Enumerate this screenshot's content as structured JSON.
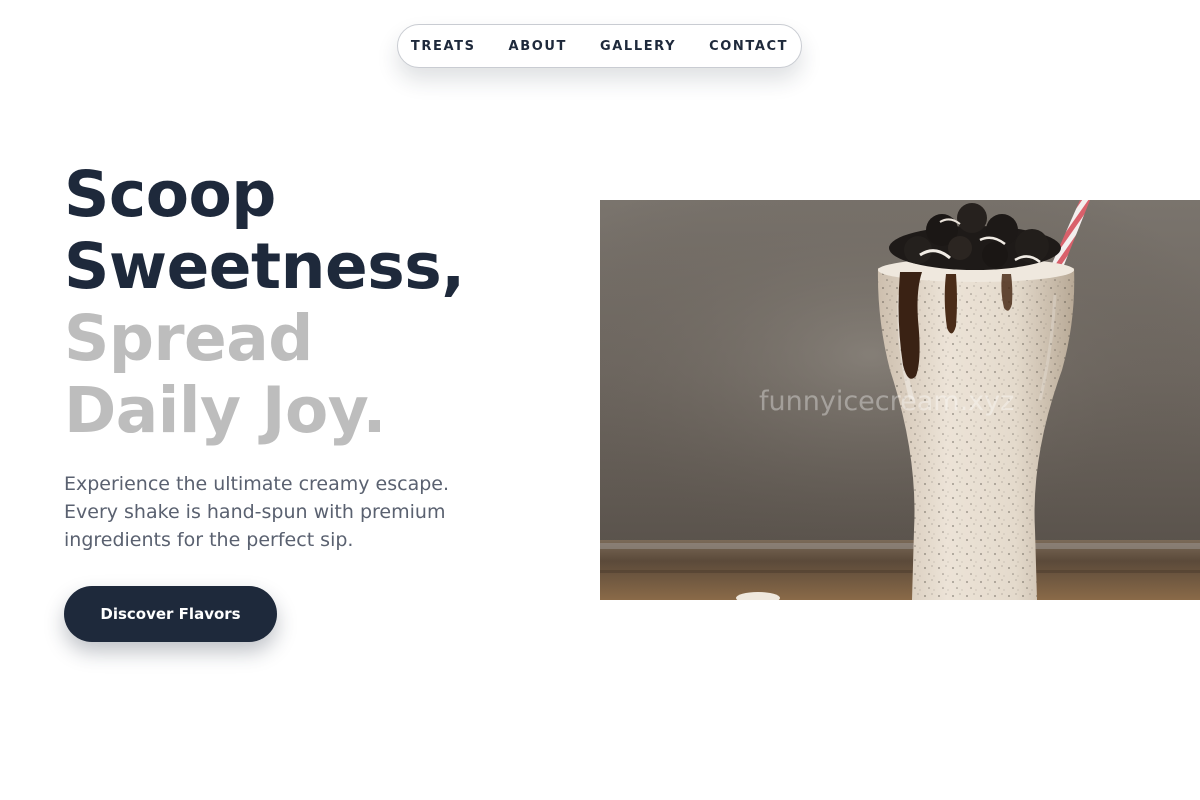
{
  "nav": {
    "items": [
      {
        "label": "TREATS"
      },
      {
        "label": "ABOUT"
      },
      {
        "label": "GALLERY"
      },
      {
        "label": "CONTACT"
      }
    ]
  },
  "hero": {
    "headline": {
      "line1": "Scoop",
      "line2": "Sweetness,",
      "line3": "Spread",
      "line4": "Daily Joy."
    },
    "description": {
      "line1": "Experience the ultimate creamy escape.",
      "line2": "Every shake is hand-spun with premium",
      "line3": "ingredients for the perfect sip."
    },
    "cta_label": "Discover Flavors",
    "image": {
      "subject": "cookies-and-cream milkshake with chocolate drizzle and striped straw",
      "watermark": "funnyicecream.xyz"
    }
  },
  "colors": {
    "primary": "#1e293b",
    "muted_headline": "#bdbdbd",
    "body_text": "#5a6170",
    "background": "#ffffff"
  }
}
